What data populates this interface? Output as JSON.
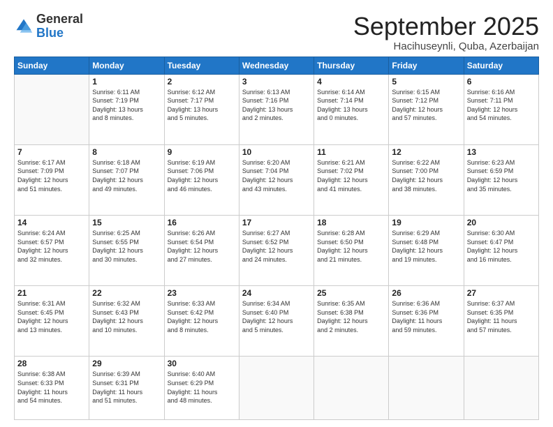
{
  "logo": {
    "general": "General",
    "blue": "Blue"
  },
  "header": {
    "month": "September 2025",
    "location": "Hacihuseynli, Quba, Azerbaijan"
  },
  "weekdays": [
    "Sunday",
    "Monday",
    "Tuesday",
    "Wednesday",
    "Thursday",
    "Friday",
    "Saturday"
  ],
  "weeks": [
    [
      {
        "day": "",
        "info": ""
      },
      {
        "day": "1",
        "info": "Sunrise: 6:11 AM\nSunset: 7:19 PM\nDaylight: 13 hours\nand 8 minutes."
      },
      {
        "day": "2",
        "info": "Sunrise: 6:12 AM\nSunset: 7:17 PM\nDaylight: 13 hours\nand 5 minutes."
      },
      {
        "day": "3",
        "info": "Sunrise: 6:13 AM\nSunset: 7:16 PM\nDaylight: 13 hours\nand 2 minutes."
      },
      {
        "day": "4",
        "info": "Sunrise: 6:14 AM\nSunset: 7:14 PM\nDaylight: 13 hours\nand 0 minutes."
      },
      {
        "day": "5",
        "info": "Sunrise: 6:15 AM\nSunset: 7:12 PM\nDaylight: 12 hours\nand 57 minutes."
      },
      {
        "day": "6",
        "info": "Sunrise: 6:16 AM\nSunset: 7:11 PM\nDaylight: 12 hours\nand 54 minutes."
      }
    ],
    [
      {
        "day": "7",
        "info": "Sunrise: 6:17 AM\nSunset: 7:09 PM\nDaylight: 12 hours\nand 51 minutes."
      },
      {
        "day": "8",
        "info": "Sunrise: 6:18 AM\nSunset: 7:07 PM\nDaylight: 12 hours\nand 49 minutes."
      },
      {
        "day": "9",
        "info": "Sunrise: 6:19 AM\nSunset: 7:06 PM\nDaylight: 12 hours\nand 46 minutes."
      },
      {
        "day": "10",
        "info": "Sunrise: 6:20 AM\nSunset: 7:04 PM\nDaylight: 12 hours\nand 43 minutes."
      },
      {
        "day": "11",
        "info": "Sunrise: 6:21 AM\nSunset: 7:02 PM\nDaylight: 12 hours\nand 41 minutes."
      },
      {
        "day": "12",
        "info": "Sunrise: 6:22 AM\nSunset: 7:00 PM\nDaylight: 12 hours\nand 38 minutes."
      },
      {
        "day": "13",
        "info": "Sunrise: 6:23 AM\nSunset: 6:59 PM\nDaylight: 12 hours\nand 35 minutes."
      }
    ],
    [
      {
        "day": "14",
        "info": "Sunrise: 6:24 AM\nSunset: 6:57 PM\nDaylight: 12 hours\nand 32 minutes."
      },
      {
        "day": "15",
        "info": "Sunrise: 6:25 AM\nSunset: 6:55 PM\nDaylight: 12 hours\nand 30 minutes."
      },
      {
        "day": "16",
        "info": "Sunrise: 6:26 AM\nSunset: 6:54 PM\nDaylight: 12 hours\nand 27 minutes."
      },
      {
        "day": "17",
        "info": "Sunrise: 6:27 AM\nSunset: 6:52 PM\nDaylight: 12 hours\nand 24 minutes."
      },
      {
        "day": "18",
        "info": "Sunrise: 6:28 AM\nSunset: 6:50 PM\nDaylight: 12 hours\nand 21 minutes."
      },
      {
        "day": "19",
        "info": "Sunrise: 6:29 AM\nSunset: 6:48 PM\nDaylight: 12 hours\nand 19 minutes."
      },
      {
        "day": "20",
        "info": "Sunrise: 6:30 AM\nSunset: 6:47 PM\nDaylight: 12 hours\nand 16 minutes."
      }
    ],
    [
      {
        "day": "21",
        "info": "Sunrise: 6:31 AM\nSunset: 6:45 PM\nDaylight: 12 hours\nand 13 minutes."
      },
      {
        "day": "22",
        "info": "Sunrise: 6:32 AM\nSunset: 6:43 PM\nDaylight: 12 hours\nand 10 minutes."
      },
      {
        "day": "23",
        "info": "Sunrise: 6:33 AM\nSunset: 6:42 PM\nDaylight: 12 hours\nand 8 minutes."
      },
      {
        "day": "24",
        "info": "Sunrise: 6:34 AM\nSunset: 6:40 PM\nDaylight: 12 hours\nand 5 minutes."
      },
      {
        "day": "25",
        "info": "Sunrise: 6:35 AM\nSunset: 6:38 PM\nDaylight: 12 hours\nand 2 minutes."
      },
      {
        "day": "26",
        "info": "Sunrise: 6:36 AM\nSunset: 6:36 PM\nDaylight: 11 hours\nand 59 minutes."
      },
      {
        "day": "27",
        "info": "Sunrise: 6:37 AM\nSunset: 6:35 PM\nDaylight: 11 hours\nand 57 minutes."
      }
    ],
    [
      {
        "day": "28",
        "info": "Sunrise: 6:38 AM\nSunset: 6:33 PM\nDaylight: 11 hours\nand 54 minutes."
      },
      {
        "day": "29",
        "info": "Sunrise: 6:39 AM\nSunset: 6:31 PM\nDaylight: 11 hours\nand 51 minutes."
      },
      {
        "day": "30",
        "info": "Sunrise: 6:40 AM\nSunset: 6:29 PM\nDaylight: 11 hours\nand 48 minutes."
      },
      {
        "day": "",
        "info": ""
      },
      {
        "day": "",
        "info": ""
      },
      {
        "day": "",
        "info": ""
      },
      {
        "day": "",
        "info": ""
      }
    ]
  ]
}
